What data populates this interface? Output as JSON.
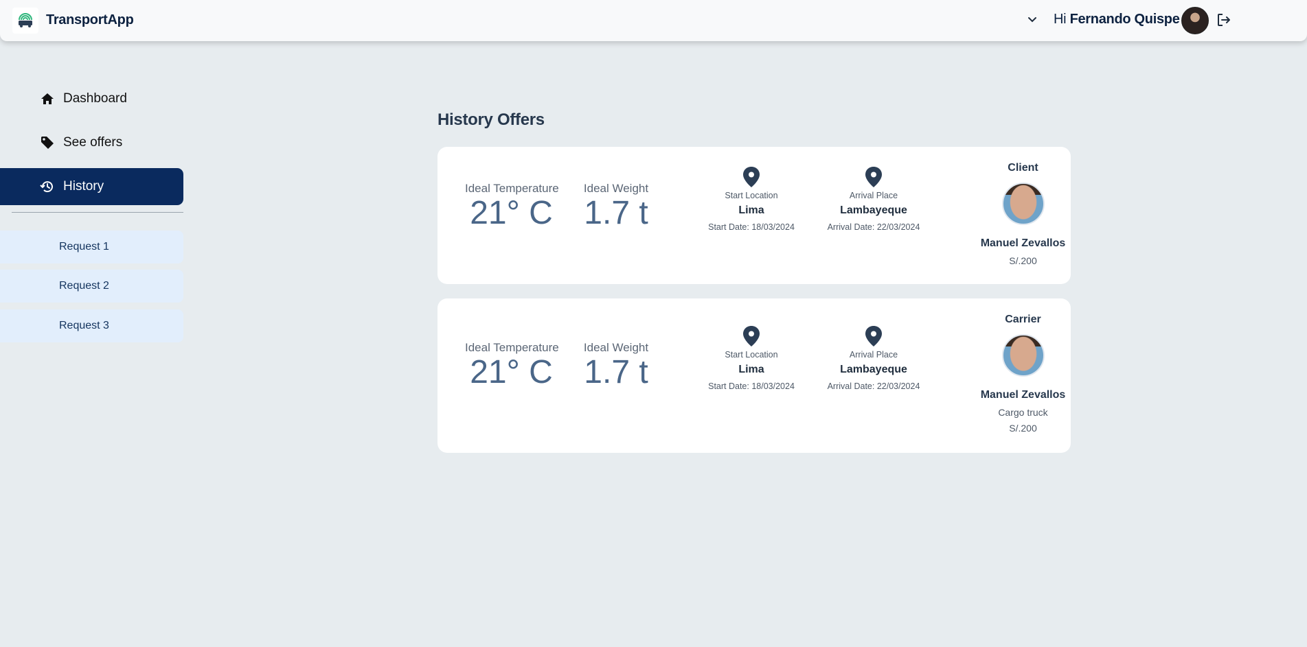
{
  "header": {
    "app_title": "TransportApp",
    "greeting": "Hi",
    "user_name": "Fernando Quispe"
  },
  "sidebar": {
    "items": [
      {
        "label": "Dashboard",
        "icon": "home-icon",
        "active": false
      },
      {
        "label": "See offers",
        "icon": "tag-icon",
        "active": false
      },
      {
        "label": "History",
        "icon": "history-icon",
        "active": true
      }
    ],
    "requests": [
      "Request 1",
      "Request 2",
      "Request 3"
    ]
  },
  "main": {
    "title": "History Offers",
    "cards": [
      {
        "temperature_label": "Ideal Temperature",
        "temperature_value": "21° C",
        "weight_label": "Ideal Weight",
        "weight_value": "1.7 t",
        "start_label": "Start Location",
        "start_place": "Lima",
        "start_date": "Start Date: 18/03/2024",
        "arrival_label": "Arrival Place",
        "arrival_place": "Lambayeque",
        "arrival_date": "Arrival Date: 22/03/2024",
        "role": "Client",
        "person_name": "Manuel Zevallos",
        "price": "S/.200"
      },
      {
        "temperature_label": "Ideal Temperature",
        "temperature_value": "21° C",
        "weight_label": "Ideal Weight",
        "weight_value": "1.7 t",
        "start_label": "Start Location",
        "start_place": "Lima",
        "start_date": "Start Date: 18/03/2024",
        "arrival_label": "Arrival Place",
        "arrival_place": "Lambayeque",
        "arrival_date": "Arrival Date: 22/03/2024",
        "role": "Carrier",
        "person_name": "Manuel Zevallos",
        "vehicle": "Cargo truck",
        "price": "S/.200"
      }
    ]
  },
  "colors": {
    "background": "#e7ecef",
    "nav_active": "#0a2a5e",
    "request_bg": "#e2eefc",
    "value_text": "#4a6688"
  }
}
